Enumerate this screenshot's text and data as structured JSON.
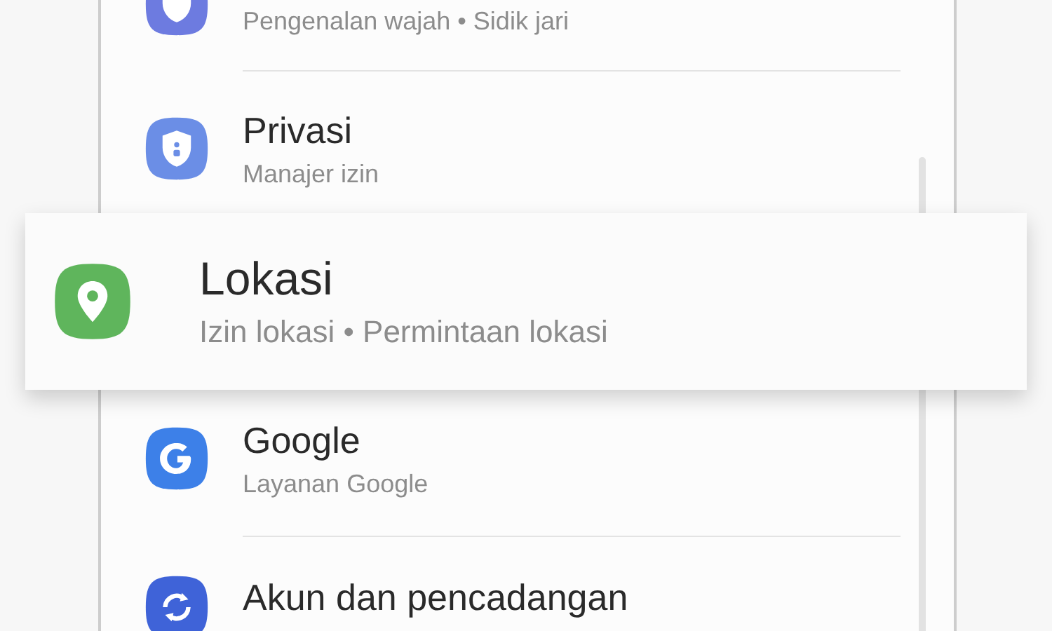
{
  "settings_list": [
    {
      "kind": "shield",
      "subtitle": "Pengenalan wajah • Sidik jari"
    },
    {
      "kind": "privacy",
      "title": "Privasi",
      "subtitle": "Manajer izin"
    },
    {
      "kind": "hidden"
    },
    {
      "kind": "google",
      "title": "Google",
      "subtitle": "Layanan Google"
    },
    {
      "kind": "sync",
      "title": "Akun dan pencadangan"
    }
  ],
  "highlighted_item": {
    "kind": "location",
    "title": "Lokasi",
    "subtitle": "Izin lokasi • Permintaan lokasi"
  }
}
